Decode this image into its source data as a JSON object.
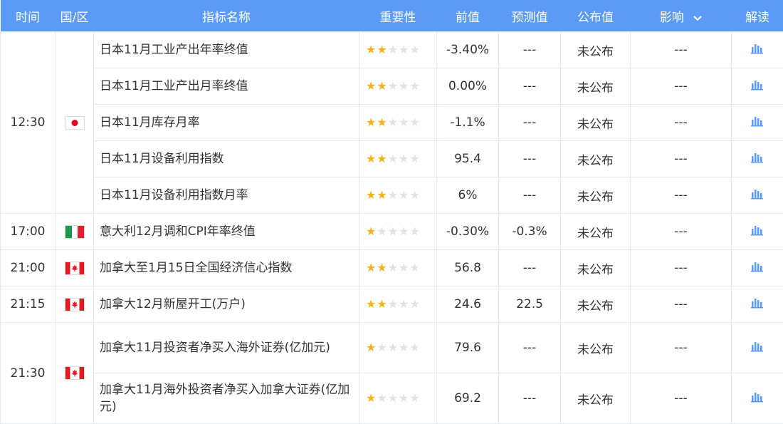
{
  "header": {
    "time": "时间",
    "country": "国/区",
    "name": "指标名称",
    "importance": "重要性",
    "previous": "前值",
    "forecast": "预测值",
    "actual": "公布值",
    "influence": "影响",
    "interpret": "解读"
  },
  "colors": {
    "header_bg": "#5b9bf5",
    "star_on": "#f5b31b",
    "star_off": "#dfe3ea",
    "chart_icon": "#5b9bf5"
  },
  "groups": [
    {
      "time": "12:30",
      "flag": "japan-flag-icon",
      "rows": [
        {
          "name": "日本11月工业产出年率终值",
          "stars": 2,
          "previous": "-3.40%",
          "forecast": "---",
          "actual": "未公布",
          "influence": "---"
        },
        {
          "name": "日本11月工业产出月率终值",
          "stars": 2,
          "previous": "0.00%",
          "forecast": "---",
          "actual": "未公布",
          "influence": "---"
        },
        {
          "name": "日本11月库存月率",
          "stars": 2,
          "previous": "-1.1%",
          "forecast": "---",
          "actual": "未公布",
          "influence": "---"
        },
        {
          "name": "日本11月设备利用指数",
          "stars": 2,
          "previous": "95.4",
          "forecast": "---",
          "actual": "未公布",
          "influence": "---"
        },
        {
          "name": "日本11月设备利用指数月率",
          "stars": 2,
          "previous": "6%",
          "forecast": "---",
          "actual": "未公布",
          "influence": "---"
        }
      ]
    },
    {
      "time": "17:00",
      "flag": "italy-flag-icon",
      "rows": [
        {
          "name": "意大利12月调和CPI年率终值",
          "stars": 1,
          "previous": "-0.30%",
          "forecast": "-0.3%",
          "actual": "未公布",
          "influence": "---"
        }
      ]
    },
    {
      "time": "21:00",
      "flag": "canada-flag-icon",
      "rows": [
        {
          "name": "加拿大至1月15日全国经济信心指数",
          "stars": 2,
          "previous": "56.8",
          "forecast": "---",
          "actual": "未公布",
          "influence": "---"
        }
      ]
    },
    {
      "time": "21:15",
      "flag": "canada-flag-icon",
      "rows": [
        {
          "name": "加拿大12月新屋开工(万户)",
          "stars": 2,
          "previous": "24.6",
          "forecast": "22.5",
          "actual": "未公布",
          "influence": "---"
        }
      ]
    },
    {
      "time": "21:30",
      "flag": "canada-flag-icon",
      "rows": [
        {
          "name": "加拿大11月投资者净买入海外证券(亿加元)",
          "stars": 1,
          "previous": "79.6",
          "forecast": "---",
          "actual": "未公布",
          "influence": "---"
        },
        {
          "name": "加拿大11月海外投资者净买入加拿大证券(亿加元)",
          "stars": 1,
          "previous": "69.2",
          "forecast": "---",
          "actual": "未公布",
          "influence": "---"
        }
      ]
    }
  ]
}
